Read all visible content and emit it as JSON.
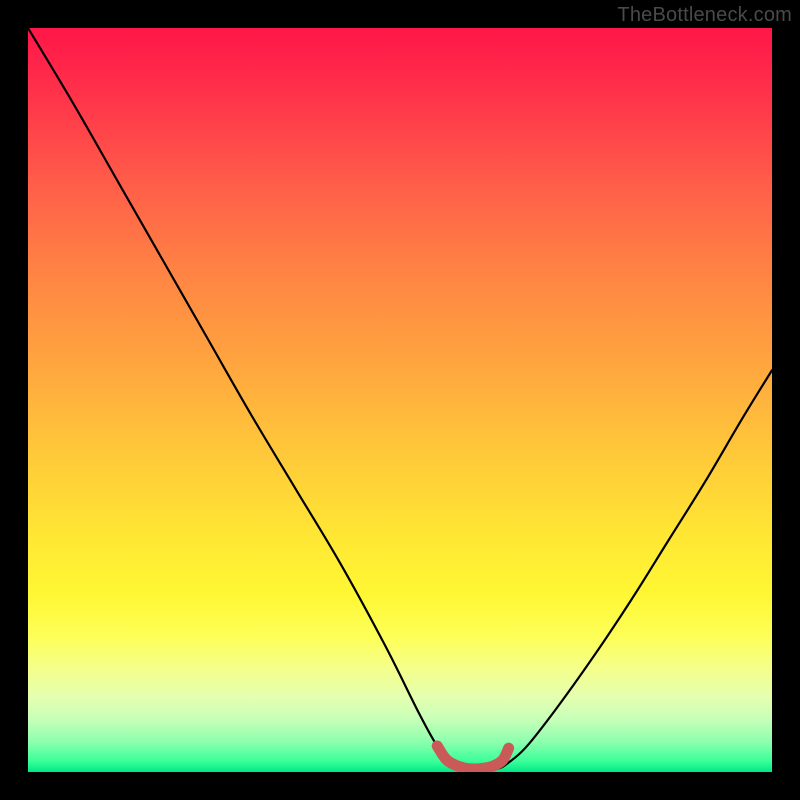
{
  "watermark": "TheBottleneck.com",
  "chart_data": {
    "type": "line",
    "title": "",
    "xlabel": "",
    "ylabel": "",
    "xlim": [
      0,
      100
    ],
    "ylim": [
      0,
      100
    ],
    "grid": false,
    "series": [
      {
        "name": "bottleneck-curve",
        "color": "#000000",
        "x": [
          0,
          6,
          12,
          18,
          24,
          30,
          36,
          42,
          48,
          52.5,
          55,
          57,
          59,
          61,
          63,
          64.5,
          67,
          71,
          76,
          81,
          86,
          91,
          96,
          100
        ],
        "y": [
          100,
          90,
          79.5,
          69,
          58.5,
          48,
          38,
          28,
          17,
          8,
          3.5,
          1.2,
          0.4,
          0.3,
          0.4,
          1.2,
          3.4,
          8.5,
          15.5,
          23,
          31,
          39,
          47.5,
          54
        ]
      },
      {
        "name": "optimal-range-marker",
        "color": "#c95a57",
        "x": [
          55,
          56.2,
          57.5,
          58.8,
          60,
          61.2,
          62.5,
          63.8,
          64.6
        ],
        "y": [
          3.5,
          1.7,
          0.9,
          0.5,
          0.4,
          0.5,
          0.8,
          1.6,
          3.2
        ]
      }
    ]
  }
}
